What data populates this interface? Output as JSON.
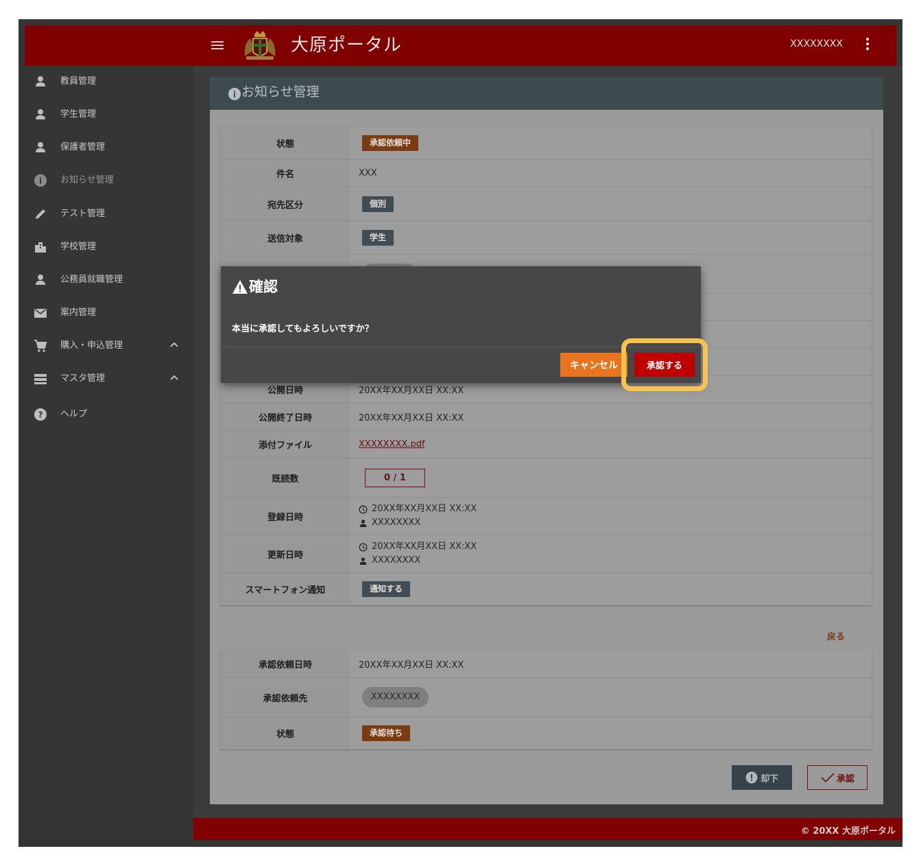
{
  "header": {
    "title": "大原ポータル",
    "user": "XXXXXXXX"
  },
  "sidebar": {
    "items": [
      {
        "label": "教員管理",
        "icon": "person-icon"
      },
      {
        "label": "学生管理",
        "icon": "person-icon"
      },
      {
        "label": "保護者管理",
        "icon": "person-icon"
      },
      {
        "label": "お知らせ管理",
        "icon": "info-icon"
      },
      {
        "label": "テスト管理",
        "icon": "pencil-icon"
      },
      {
        "label": "学校管理",
        "icon": "building-icon"
      },
      {
        "label": "公務員就職管理",
        "icon": "person-icon"
      },
      {
        "label": "案内管理",
        "icon": "mail-icon"
      },
      {
        "label": "購入・申込管理",
        "icon": "cart-icon"
      },
      {
        "label": "マスタ管理",
        "icon": "list-icon"
      },
      {
        "label": "ヘルプ",
        "icon": "help-icon"
      }
    ]
  },
  "panel": {
    "title": "お知らせ管理"
  },
  "detail": {
    "status_label": "状態",
    "status_value": "承認依頼中",
    "subject_label": "件名",
    "subject_value": "XXX",
    "dest_type_label": "宛先区分",
    "dest_type_value": "個別",
    "target_label": "送信対象",
    "target_value": "学生",
    "publish_label": "公開日時",
    "publish_value": "20XX年XX月XX日 XX:XX",
    "publish_end_label": "公開終了日時",
    "publish_end_value": "20XX年XX月XX日 XX:XX",
    "attachment_label": "添付ファイル",
    "attachment_value": "XXXXXXXX.pdf",
    "read_label": "既読数",
    "read_value": "0 / 1",
    "registered_label": "登録日時",
    "registered_date": "20XX年XX月XX日 XX:XX",
    "registered_user": "XXXXXXXX",
    "updated_label": "更新日時",
    "updated_date": "20XX年XX月XX日 XX:XX",
    "updated_user": "XXXXXXXX",
    "smartphone_label": "スマートフォン通知",
    "smartphone_value": "通知する"
  },
  "back_label": "戻る",
  "approval": {
    "request_date_label": "承認依頼日時",
    "request_date_value": "20XX年XX月XX日 XX:XX",
    "request_to_label": "承認依頼先",
    "request_to_value": "XXXXXXXX",
    "status_label": "状態",
    "status_value": "承認待ち"
  },
  "actions": {
    "reject": "却下",
    "approve": "承認"
  },
  "dialog": {
    "title": "確認",
    "message": "本当に承認してもよろしいですか？",
    "cancel": "キャンセル",
    "confirm": "承認する"
  },
  "footer": {
    "copyright": "© 20XX 大原ポータル"
  },
  "colors": {
    "brand": "#800000",
    "dialog_cancel": "#e8741d",
    "dialog_confirm": "#c00000",
    "highlight": "#f6c34f"
  }
}
